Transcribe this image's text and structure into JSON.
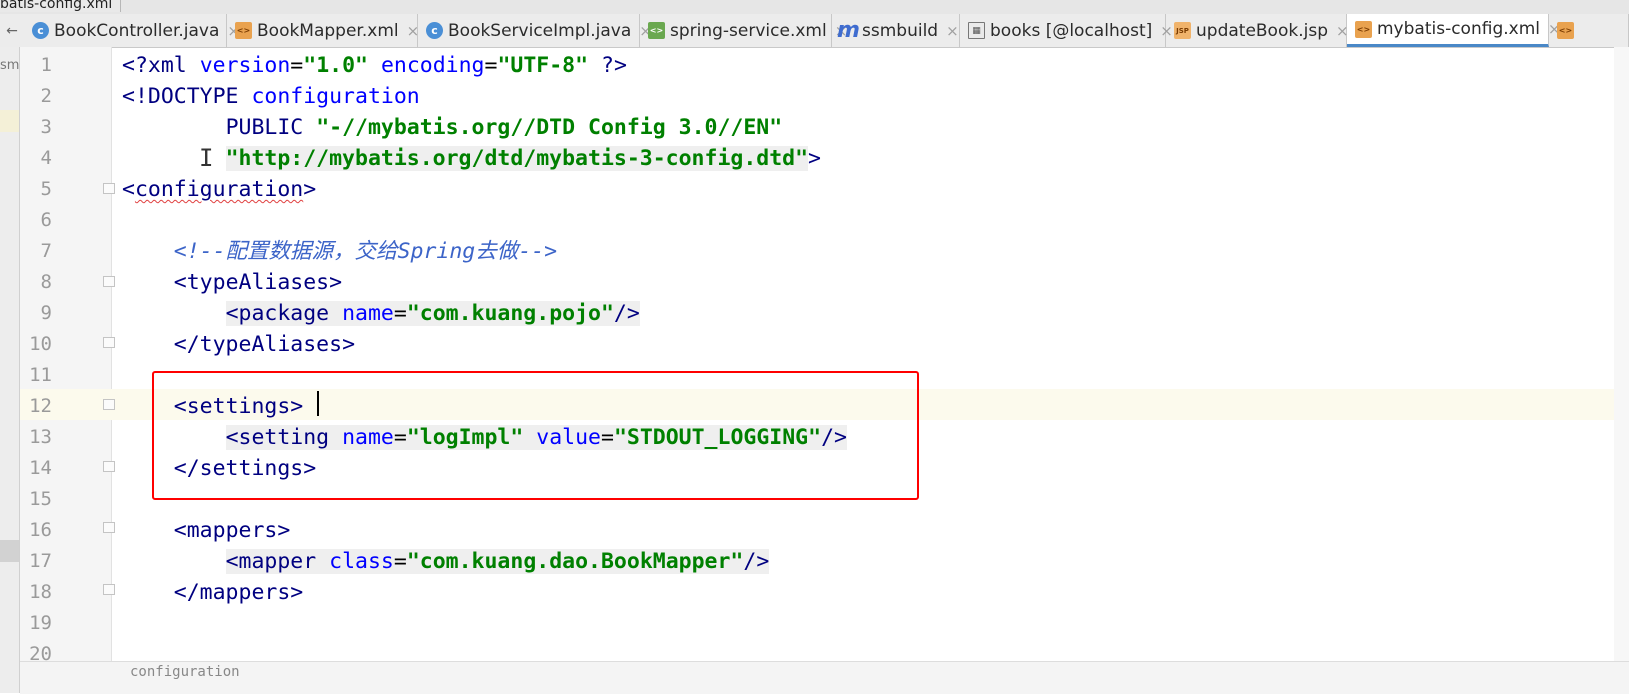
{
  "breadcrumb": "batis-config.xml",
  "tabs": [
    {
      "label": "BookController.java",
      "icon": "java-class-icon",
      "active": false
    },
    {
      "label": "BookMapper.xml",
      "icon": "xml-file-icon",
      "active": false
    },
    {
      "label": "BookServiceImpl.java",
      "icon": "java-class-icon",
      "active": false
    },
    {
      "label": "spring-service.xml",
      "icon": "spring-xml-icon",
      "active": false
    },
    {
      "label": "ssmbuild",
      "icon": "maven-module-icon",
      "active": false
    },
    {
      "label": "books [@localhost]",
      "icon": "database-table-icon",
      "active": false
    },
    {
      "label": "updateBook.jsp",
      "icon": "jsp-file-icon",
      "active": false
    },
    {
      "label": "mybatis-config.xml",
      "icon": "xml-file-icon",
      "active": true
    }
  ],
  "tab_close_glyph": "×",
  "left_tool_label": "sm",
  "line_numbers": [
    "1",
    "2",
    "3",
    "4",
    "5",
    "6",
    "7",
    "8",
    "9",
    "10",
    "11",
    "12",
    "13",
    "14",
    "15",
    "16",
    "17",
    "18",
    "19",
    "20"
  ],
  "code": {
    "l1": {
      "open": "<?",
      "tag": "xml",
      "a1": "version",
      "v1": "\"1.0\"",
      "a2": "encoding",
      "v2": "\"UTF-8\"",
      "close": "?>"
    },
    "l2": {
      "doctype": "<!DOCTYPE",
      "name": "configuration"
    },
    "l3": {
      "kw": "PUBLIC",
      "val": "\"-//mybatis.org//DTD Config 3.0//EN\""
    },
    "l4": {
      "val": "\"http://mybatis.org/dtd/mybatis-3-config.dtd\"",
      "close": ">"
    },
    "l5": {
      "tag": "configuration"
    },
    "l7": {
      "comment": "<!--配置数据源，交给Spring去做-->"
    },
    "l8": {
      "tag": "typeAliases"
    },
    "l9": {
      "tag": "package",
      "attr": "name",
      "val": "\"com.kuang.pojo\""
    },
    "l10": {
      "tag": "typeAliases"
    },
    "l12": {
      "tag": "settings"
    },
    "l13": {
      "tag": "setting",
      "a1": "name",
      "v1": "\"logImpl\"",
      "a2": "value",
      "v2": "\"STDOUT_LOGGING\""
    },
    "l14": {
      "tag": "settings"
    },
    "l16": {
      "tag": "mappers"
    },
    "l17": {
      "tag": "mapper",
      "attr": "class",
      "val": "\"com.kuang.dao.BookMapper\""
    },
    "l18": {
      "tag": "mappers"
    }
  },
  "bottom_hint": "configuration",
  "colors": {
    "highlight_box": "#ff0000",
    "active_tab_underline": "#4a88c7",
    "tag": "#000080",
    "attribute": "#0000ff",
    "string": "#008000",
    "comment": "#3c64c8"
  }
}
